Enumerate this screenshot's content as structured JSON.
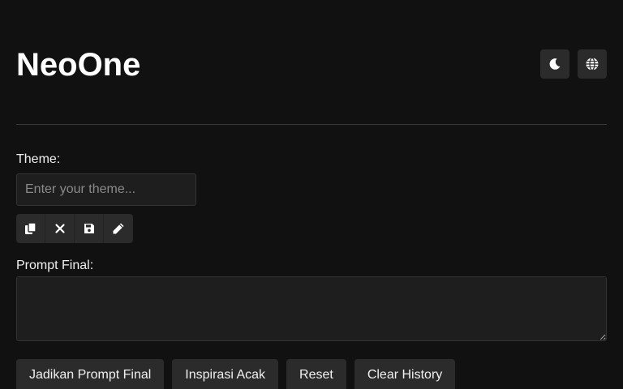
{
  "app": {
    "title": "NeoOne"
  },
  "header": {
    "actions": [
      {
        "icon": "moon-icon"
      },
      {
        "icon": "globe-icon"
      }
    ]
  },
  "theme": {
    "label": "Theme:",
    "placeholder": "Enter your theme...",
    "value": ""
  },
  "tools": [
    {
      "icon": "copy-icon"
    },
    {
      "icon": "close-icon"
    },
    {
      "icon": "save-icon"
    },
    {
      "icon": "pencil-icon"
    }
  ],
  "prompt": {
    "label": "Prompt Final:",
    "value": ""
  },
  "actions": {
    "make_final": "Jadikan Prompt Final",
    "random_inspiration": "Inspirasi Acak",
    "reset": "Reset",
    "clear_history": "Clear History"
  },
  "colors": {
    "background": "#111111",
    "surface": "#1e1e1e",
    "button": "#2b2b2b",
    "text": "#f0f0f0"
  }
}
